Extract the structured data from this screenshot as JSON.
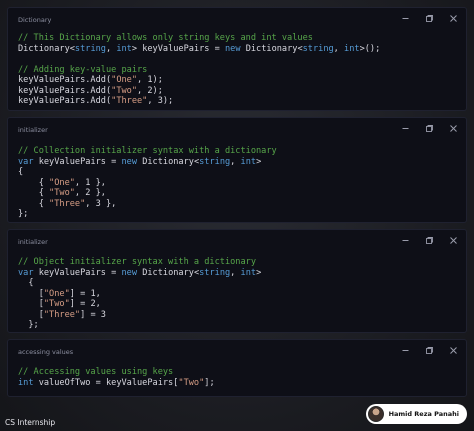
{
  "windows": [
    {
      "title": "Dictionary",
      "lines": [
        [
          {
            "c": "cm",
            "t": "// This Dictionary allows only string keys and int values"
          }
        ],
        [
          {
            "c": "pl",
            "t": "Dictionary<"
          },
          {
            "c": "kw",
            "t": "string"
          },
          {
            "c": "pl",
            "t": ", "
          },
          {
            "c": "kw",
            "t": "int"
          },
          {
            "c": "pl",
            "t": "> keyValuePairs = "
          },
          {
            "c": "kw",
            "t": "new"
          },
          {
            "c": "pl",
            "t": " Dictionary<"
          },
          {
            "c": "kw",
            "t": "string"
          },
          {
            "c": "pl",
            "t": ", "
          },
          {
            "c": "kw",
            "t": "int"
          },
          {
            "c": "pl",
            "t": ">();"
          }
        ],
        [
          {
            "c": "pl",
            "t": ""
          }
        ],
        [
          {
            "c": "cm",
            "t": "// Adding key-value pairs"
          }
        ],
        [
          {
            "c": "pl",
            "t": "keyValuePairs.Add("
          },
          {
            "c": "st",
            "t": "\"One\""
          },
          {
            "c": "pl",
            "t": ", 1);"
          }
        ],
        [
          {
            "c": "pl",
            "t": "keyValuePairs.Add("
          },
          {
            "c": "st",
            "t": "\"Two\""
          },
          {
            "c": "pl",
            "t": ", 2);"
          }
        ],
        [
          {
            "c": "pl",
            "t": "keyValuePairs.Add("
          },
          {
            "c": "st",
            "t": "\"Three\""
          },
          {
            "c": "pl",
            "t": ", 3);"
          }
        ]
      ]
    },
    {
      "title": "initializer",
      "lines": [
        [
          {
            "c": "cm",
            "t": "// Collection initializer syntax with a dictionary"
          }
        ],
        [
          {
            "c": "kw",
            "t": "var"
          },
          {
            "c": "pl",
            "t": " keyValuePairs = "
          },
          {
            "c": "kw",
            "t": "new"
          },
          {
            "c": "pl",
            "t": " Dictionary<"
          },
          {
            "c": "kw",
            "t": "string"
          },
          {
            "c": "pl",
            "t": ", "
          },
          {
            "c": "kw",
            "t": "int"
          },
          {
            "c": "pl",
            "t": ">"
          }
        ],
        [
          {
            "c": "pl",
            "t": "{"
          }
        ],
        [
          {
            "c": "pl",
            "t": "    { "
          },
          {
            "c": "st",
            "t": "\"One\""
          },
          {
            "c": "pl",
            "t": ", 1 },"
          }
        ],
        [
          {
            "c": "pl",
            "t": "    { "
          },
          {
            "c": "st",
            "t": "\"Two\""
          },
          {
            "c": "pl",
            "t": ", 2 },"
          }
        ],
        [
          {
            "c": "pl",
            "t": "    { "
          },
          {
            "c": "st",
            "t": "\"Three\""
          },
          {
            "c": "pl",
            "t": ", 3 },"
          }
        ],
        [
          {
            "c": "pl",
            "t": "};"
          }
        ]
      ]
    },
    {
      "title": "initializer",
      "lines": [
        [
          {
            "c": "cm",
            "t": "// Object initializer syntax with a dictionary"
          }
        ],
        [
          {
            "c": "kw",
            "t": "var"
          },
          {
            "c": "pl",
            "t": " keyValuePairs = "
          },
          {
            "c": "kw",
            "t": "new"
          },
          {
            "c": "pl",
            "t": " Dictionary<"
          },
          {
            "c": "kw",
            "t": "string"
          },
          {
            "c": "pl",
            "t": ", "
          },
          {
            "c": "kw",
            "t": "int"
          },
          {
            "c": "pl",
            "t": ">"
          }
        ],
        [
          {
            "c": "pl",
            "t": "  {"
          }
        ],
        [
          {
            "c": "pl",
            "t": "    ["
          },
          {
            "c": "st",
            "t": "\"One\""
          },
          {
            "c": "pl",
            "t": "] = 1,"
          }
        ],
        [
          {
            "c": "pl",
            "t": "    ["
          },
          {
            "c": "st",
            "t": "\"Two\""
          },
          {
            "c": "pl",
            "t": "] = 2,"
          }
        ],
        [
          {
            "c": "pl",
            "t": "    ["
          },
          {
            "c": "st",
            "t": "\"Three\""
          },
          {
            "c": "pl",
            "t": "] = 3"
          }
        ],
        [
          {
            "c": "pl",
            "t": "  };"
          }
        ]
      ]
    },
    {
      "title": "accessing values",
      "lines": [
        [
          {
            "c": "cm",
            "t": "// Accessing values using keys"
          }
        ],
        [
          {
            "c": "kw",
            "t": "int"
          },
          {
            "c": "pl",
            "t": " valueOfTwo = keyValuePairs["
          },
          {
            "c": "st",
            "t": "\"Two\""
          },
          {
            "c": "pl",
            "t": "];"
          }
        ]
      ]
    }
  ],
  "window_controls": [
    "minimize-icon",
    "restore-icon",
    "close-icon"
  ],
  "footer": {
    "label": "CS Internship",
    "user_name": "Hamid Reza Panahi"
  },
  "colors": {
    "comment": "#57a64a",
    "keyword": "#569cd6",
    "string": "#d69d85",
    "plain": "#d8d8e0"
  }
}
